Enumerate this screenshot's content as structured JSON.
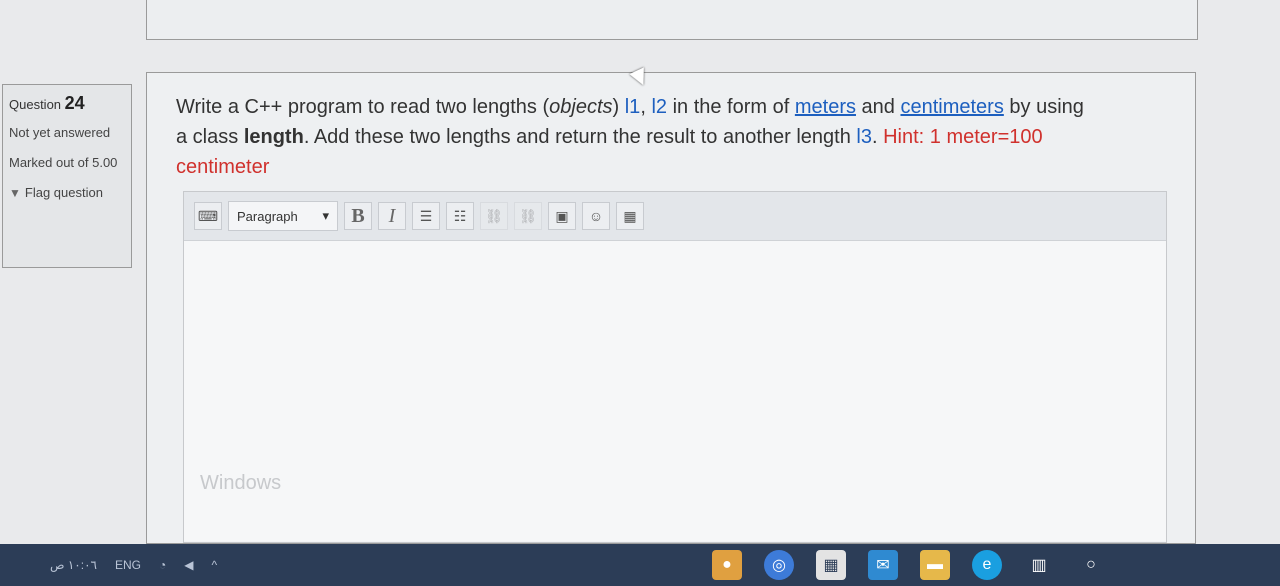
{
  "question": {
    "label": "Question",
    "number": "24",
    "state": "Not yet answered",
    "marked": "Marked out of 5.00",
    "flag_label": "Flag question"
  },
  "qtext": {
    "line1_a": "Write a C++ program to read two lengths (",
    "line1_objects": "objects",
    "line1_b": ") ",
    "l1": "l1",
    "comma": ", ",
    "l2": "l2",
    "line1_c": " in the form of ",
    "meters": "meters",
    "and": " and ",
    "centimeters": "centimeters",
    "line1_d": " by using",
    "line2_a": "a class ",
    "length_word": "length",
    "line2_b": ". Add these two lengths and return the result to another length ",
    "l3": "l3",
    "dot": ". ",
    "hint": "Hint: 1 meter=100",
    "hint_tail": "centimeter"
  },
  "editor": {
    "paragraph": "Paragraph",
    "bold": "B",
    "italic": "I"
  },
  "watermark": "Windows",
  "taskbar": {
    "lang": "ENG",
    "time": "١٠:٠٦ ص"
  },
  "colors": {
    "blue": "#1d5fbf",
    "red": "#d0312d",
    "taskbar": "#2c3d57"
  }
}
